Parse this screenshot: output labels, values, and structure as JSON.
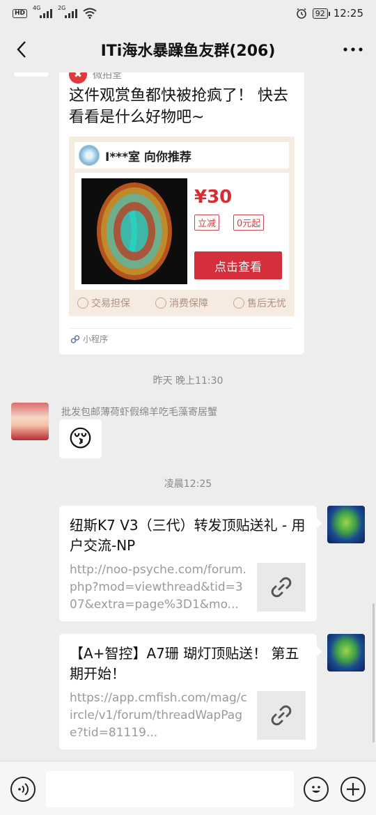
{
  "status_bar": {
    "hd": "HD",
    "signal1_gen": "4G",
    "signal2_gen": "2G",
    "battery": "92",
    "time": "12:25"
  },
  "header": {
    "title": "ITi海水暴躁鱼友群(206)"
  },
  "mini_program_card": {
    "source": "微拍堂",
    "description": "这件观赏鱼都快被抢疯了！ 快去看看是什么好物吧~",
    "shop_line": "I***室 向你推荐",
    "price": "¥30",
    "tag1": "立减",
    "tag2": "0元起",
    "button": "点击查看",
    "guarantees": [
      "交易担保",
      "消费保障",
      "售后无忧"
    ],
    "footer": "小程序"
  },
  "timestamps": {
    "t1": "昨天 晚上11:30",
    "t2": "凌晨12:25"
  },
  "message_sticker": {
    "sender": "批发包邮薄荷虾假绵羊吃毛藻寄居蟹",
    "emoji": "😚"
  },
  "link_cards": [
    {
      "title": "纽斯K7 V3（三代）转发顶贴送礼 - 用户交流-NP",
      "url": "http://noo-psyche.com/forum.php?mod=viewthread&tid=307&extra=page%3D1&mo..."
    },
    {
      "title": "【A+智控】A7珊 瑚灯顶贴送！ 第五期开始！",
      "url": "https://app.cmfish.com/mag/circle/v1/forum/threadWapPage?tid=81119..."
    }
  ],
  "input_bar": {
    "placeholder": ""
  },
  "colors": {
    "accent_red": "#d42f3a",
    "background": "#ededed"
  }
}
